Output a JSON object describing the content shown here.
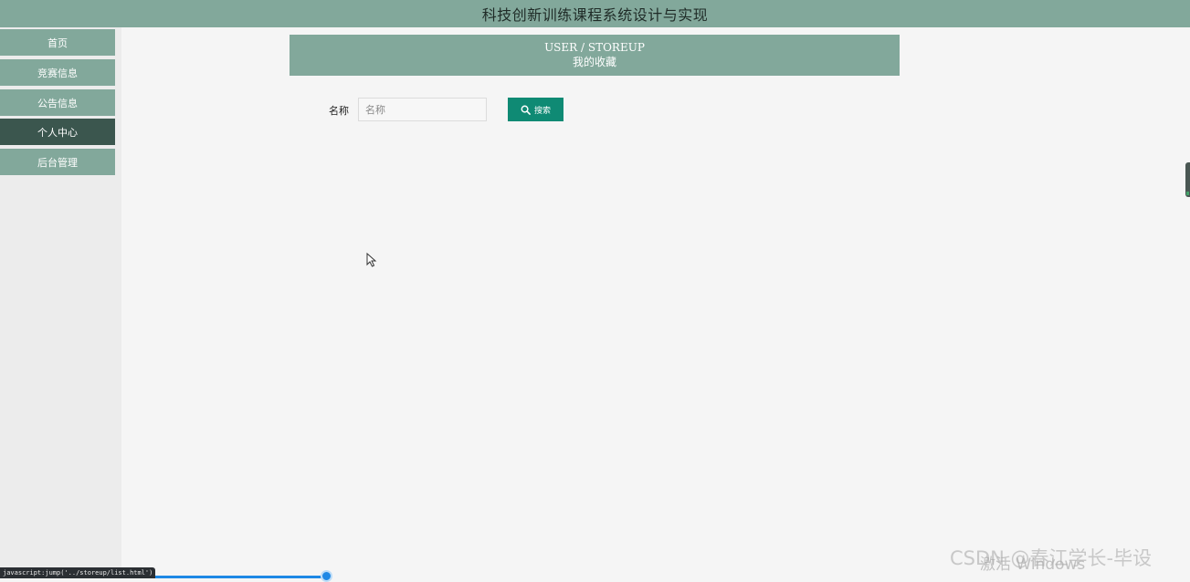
{
  "app": {
    "title": "科技创新训练课程系统设计与实现"
  },
  "sidebar": {
    "items": [
      {
        "label": "首页",
        "active": false
      },
      {
        "label": "竞赛信息",
        "active": false
      },
      {
        "label": "公告信息",
        "active": false
      },
      {
        "label": "个人中心",
        "active": true
      },
      {
        "label": "后台管理",
        "active": false
      }
    ]
  },
  "page": {
    "header_en": "USER / STOREUP",
    "header_cn": "我的收藏"
  },
  "search": {
    "label": "名称",
    "placeholder": "名称",
    "value": "",
    "button_label": "搜索",
    "button_icon": "search-icon"
  },
  "status_bar": {
    "url": "javascript:jump('../storeup/list.html')"
  },
  "watermarks": {
    "os": "激活 Windows",
    "credit": "CSDN @春江学长-毕设"
  },
  "colors": {
    "accent": "#82a89b",
    "active_nav": "#3b564e",
    "button": "#0f8a74",
    "background": "#f5f5f5",
    "sidebar_bg": "#ececec"
  }
}
